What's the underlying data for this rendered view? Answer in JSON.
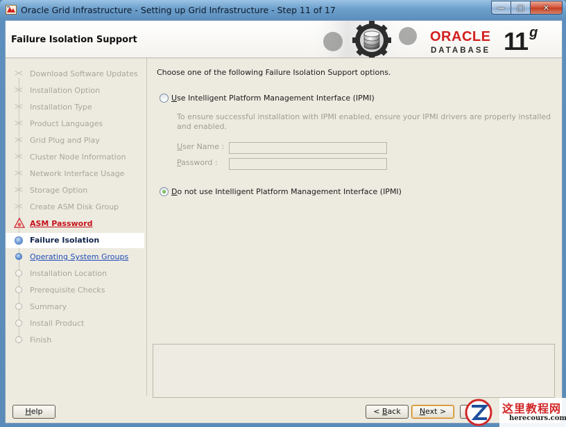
{
  "window": {
    "title": "Oracle Grid Infrastructure - Setting up Grid Infrastructure - Step 11 of 17",
    "controls": {
      "minimize": "—",
      "maximize": "□",
      "close": "✕"
    }
  },
  "header": {
    "page_title": "Failure Isolation Support",
    "brand": "ORACLE",
    "product": "DATABASE",
    "version_num": "11",
    "version_letter": "g"
  },
  "nav": {
    "items": [
      {
        "label": "Download Software Updates",
        "state": "done"
      },
      {
        "label": "Installation Option",
        "state": "done"
      },
      {
        "label": "Installation Type",
        "state": "done"
      },
      {
        "label": "Product Languages",
        "state": "done"
      },
      {
        "label": "Grid Plug and Play",
        "state": "done"
      },
      {
        "label": "Cluster Node Information",
        "state": "done"
      },
      {
        "label": "Network Interface Usage",
        "state": "done"
      },
      {
        "label": "Storage Option",
        "state": "done"
      },
      {
        "label": "Create ASM Disk Group",
        "state": "done"
      },
      {
        "label": "ASM Password",
        "state": "warning"
      },
      {
        "label": "Failure Isolation",
        "state": "current"
      },
      {
        "label": "Operating System Groups",
        "state": "next"
      },
      {
        "label": "Installation Location",
        "state": "pending"
      },
      {
        "label": "Prerequisite Checks",
        "state": "pending"
      },
      {
        "label": "Summary",
        "state": "pending"
      },
      {
        "label": "Install Product",
        "state": "pending"
      },
      {
        "label": "Finish",
        "state": "pending"
      }
    ]
  },
  "main": {
    "intro": "Choose one of the following Failure Isolation Support options.",
    "option_ipmi": {
      "mnemonic": "U",
      "rest": "se Intelligent Platform Management Interface (IPMI)",
      "selected": false
    },
    "ipmi_description": "To ensure successful installation with IPMI enabled, ensure your IPMI drivers are properly installed and enabled.",
    "username": {
      "mnemonic": "U",
      "rest": "ser Name :",
      "value": ""
    },
    "password": {
      "mnemonic": "P",
      "rest": "assword :",
      "value": ""
    },
    "option_no_ipmi": {
      "mnemonic": "D",
      "rest": "o not use Intelligent Platform Management Interface (IPMI)",
      "selected": true
    },
    "message_area": ""
  },
  "footer": {
    "help": {
      "mnemonic": "H",
      "rest": "elp"
    },
    "back": {
      "prefix": "< ",
      "mnemonic": "B",
      "rest": "ack"
    },
    "next": {
      "mnemonic": "N",
      "rest": "ext >"
    }
  },
  "watermark": {
    "text": "这里教程网",
    "url": "herecours.com"
  }
}
